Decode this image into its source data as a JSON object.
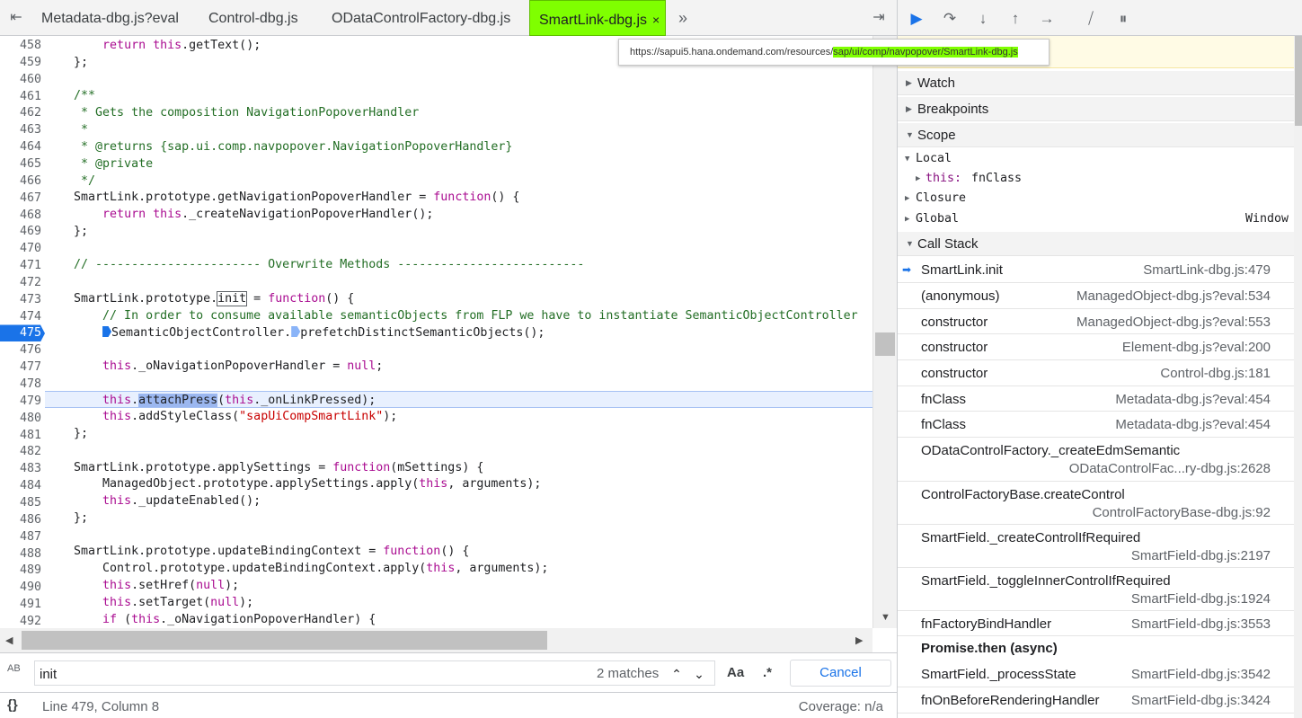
{
  "tabs": [
    {
      "label": "Metadata-dbg.js?eval",
      "active": false
    },
    {
      "label": "Control-dbg.js",
      "active": false
    },
    {
      "label": "ODataControlFactory-dbg.js",
      "active": false
    },
    {
      "label": "SmartLink-dbg.js",
      "active": true
    }
  ],
  "tab_close": "×",
  "tab_overflow": "»",
  "tooltip": {
    "prefix": "https://sapui5.hana.ondemand.com/resources/",
    "highlight": "sap/ui/comp/navpopover/SmartLink-dbg.js"
  },
  "line_numbers": [
    "458",
    "459",
    "460",
    "461",
    "462",
    "463",
    "464",
    "465",
    "466",
    "467",
    "468",
    "469",
    "470",
    "471",
    "472",
    "473",
    "474",
    "475",
    "476",
    "477",
    "478",
    "479",
    "480",
    "481",
    "482",
    "483",
    "484",
    "485",
    "486",
    "487",
    "488",
    "489",
    "490",
    "491",
    "492"
  ],
  "breakpoint_line": "475",
  "current_line": "479",
  "code": {
    "l458_a": "        ",
    "l458_kw1": "return",
    "l458_kw2": "this",
    "l458_b": ".getText();",
    "l459": "    };",
    "l461": "    /**",
    "l462": "     * Gets the composition NavigationPopoverHandler",
    "l463": "     *",
    "l464": "     * @returns {sap.ui.comp.navpopover.NavigationPopoverHandler}",
    "l465": "     * @private",
    "l466": "     */",
    "l467_a": "    SmartLink.prototype.getNavigationPopoverHandler = ",
    "l467_kw": "function",
    "l467_b": "() {",
    "l468_kw1": "return",
    "l468_kw2": "this",
    "l468_b": "._createNavigationPopoverHandler();",
    "l469": "    };",
    "l471": "    // ----------------------- Overwrite Methods --------------------------",
    "l473_a": "    SmartLink.prototype.",
    "l473_box": "init",
    "l473_b": " = ",
    "l473_kw": "function",
    "l473_c": "() {",
    "l474": "        // In order to consume available semanticObjects from FLP we have to instantiate SemanticObjectController",
    "l475_a": "SemanticObjectController.",
    "l475_b": "prefetchDistinctSemanticObjects();",
    "l477_kw": "this",
    "l477_a": "._oNavigationPopoverHandler = ",
    "l477_kw2": "null",
    "l477_b": ";",
    "l479_kw": "this",
    "l479_dot": ".",
    "l479_sel": "attachPress",
    "l479_a": "(",
    "l479_kw2": "this",
    "l479_b": "._onLinkPressed);",
    "l480_kw": "this",
    "l480_a": ".addStyleClass(",
    "l480_str": "\"sapUiCompSmartLink\"",
    "l480_b": ");",
    "l481": "    };",
    "l483_a": "    SmartLink.prototype.applySettings = ",
    "l483_kw": "function",
    "l483_b": "(mSettings) {",
    "l484_a": "        ManagedObject.prototype.applySettings.apply(",
    "l484_kw": "this",
    "l484_b": ", arguments);",
    "l485_kw": "this",
    "l485_a": "._updateEnabled();",
    "l486": "    };",
    "l488_a": "    SmartLink.prototype.updateBindingContext = ",
    "l488_kw": "function",
    "l488_b": "() {",
    "l489_a": "        Control.prototype.updateBindingContext.apply(",
    "l489_kw": "this",
    "l489_b": ", arguments);",
    "l490_kw": "this",
    "l490_a": ".setHref(",
    "l490_kw2": "null",
    "l490_b": ");",
    "l491_kw": "this",
    "l491_a": ".setTarget(",
    "l491_kw2": "null",
    "l491_b": ");",
    "l492_kw": "if",
    "l492_a": " (",
    "l492_kw2": "this",
    "l492_b": "._oNavigationPopoverHandler) {"
  },
  "find": {
    "value": "init",
    "matches": "2 matches",
    "case_label": "Aa",
    "regex_label": ".*",
    "cancel": "Cancel",
    "case_icon": "AB"
  },
  "status": {
    "braces": "{}",
    "position": "Line 479, Column 8",
    "coverage": "Coverage: n/a"
  },
  "sections": {
    "watch": "Watch",
    "breakpoints": "Breakpoints",
    "scope": "Scope",
    "call_stack": "Call Stack"
  },
  "scope": {
    "local": "Local",
    "this_key": "this:",
    "this_val": "fnClass",
    "closure": "Closure",
    "global": "Global",
    "global_val": "Window"
  },
  "call_stack": [
    {
      "fn": "SmartLink.init",
      "loc": "SmartLink-dbg.js:479"
    },
    {
      "fn": "(anonymous)",
      "loc": "ManagedObject-dbg.js?eval:534"
    },
    {
      "fn": "constructor",
      "loc": "ManagedObject-dbg.js?eval:553"
    },
    {
      "fn": "constructor",
      "loc": "Element-dbg.js?eval:200"
    },
    {
      "fn": "constructor",
      "loc": "Control-dbg.js:181"
    },
    {
      "fn": "fnClass",
      "loc": "Metadata-dbg.js?eval:454"
    },
    {
      "fn": "fnClass",
      "loc": "Metadata-dbg.js?eval:454"
    },
    {
      "fn": "ODataControlFactory._createEdmSemantic",
      "loc": "ODataControlFac...ry-dbg.js:2628"
    },
    {
      "fn": "ControlFactoryBase.createControl",
      "loc": "ControlFactoryBase-dbg.js:92"
    },
    {
      "fn": "SmartField._createControlIfRequired",
      "loc": "SmartField-dbg.js:2197"
    },
    {
      "fn": "SmartField._toggleInnerControlIfRequired",
      "loc": "SmartField-dbg.js:1924"
    },
    {
      "fn": "fnFactoryBindHandler",
      "loc": "SmartField-dbg.js:3553"
    },
    {
      "fn": "SmartField._processState",
      "loc": "SmartField-dbg.js:3542"
    },
    {
      "fn": "fnOnBeforeRenderingHandler",
      "loc": "SmartField-dbg.js:3424"
    }
  ],
  "async_label": "Promise.then (async)",
  "colors": {
    "active_tab": "#7fff00",
    "breakpoint": "#1a73e8",
    "keyword": "#aa0d91",
    "comment": "#236e25",
    "string": "#c80000"
  }
}
